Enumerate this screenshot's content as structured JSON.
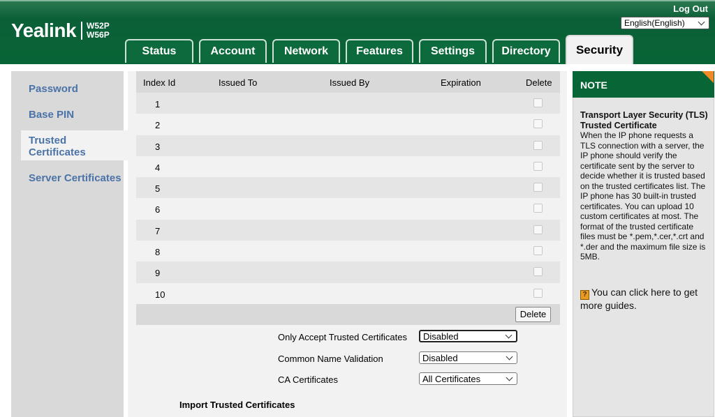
{
  "header": {
    "brand": "Yealink",
    "model_1": "W52P",
    "model_2": "W56P",
    "logout": "Log Out",
    "language": "English(English)"
  },
  "tabs": [
    {
      "label": "Status"
    },
    {
      "label": "Account"
    },
    {
      "label": "Network"
    },
    {
      "label": "Features"
    },
    {
      "label": "Settings"
    },
    {
      "label": "Directory"
    },
    {
      "label": "Security"
    }
  ],
  "sidebar": {
    "items": [
      {
        "label": "Password"
      },
      {
        "label": "Base PIN"
      },
      {
        "label": "Trusted Certificates"
      },
      {
        "label": "Server Certificates"
      }
    ]
  },
  "table": {
    "columns": [
      "Index Id",
      "Issued To",
      "Issued By",
      "Expiration",
      "Delete"
    ],
    "rows": [
      "1",
      "2",
      "3",
      "4",
      "5",
      "6",
      "7",
      "8",
      "9",
      "10"
    ],
    "delete_button": "Delete"
  },
  "form": {
    "only_accept_label": "Only Accept Trusted Certificates",
    "only_accept_value": "Disabled",
    "cn_validation_label": "Common Name Validation",
    "cn_validation_value": "Disabled",
    "ca_label": "CA Certificates",
    "ca_value": "All Certificates",
    "import_title": "Import Trusted Certificates"
  },
  "note": {
    "title": "NOTE",
    "heading1": "Transport Layer Security (TLS)",
    "heading2": "Trusted Certificate",
    "body": "When the IP phone requests a TLS connection with a server, the IP phone should verify the certificate sent by the server to decide whether it is trusted based on the trusted certificates list. The IP phone has 30 built-in trusted certificates. You can upload 10 custom certificates at most. The format of the trusted certificate files must be *.pem,*.cer,*.crt and *.der and the maximum file size is 5MB.",
    "guide_icon": "?",
    "guide": "You can click here to get more guides."
  },
  "colors": {
    "brand_green": "#086536",
    "link_blue": "#4a73a8",
    "note_corner": "#f08a24"
  }
}
